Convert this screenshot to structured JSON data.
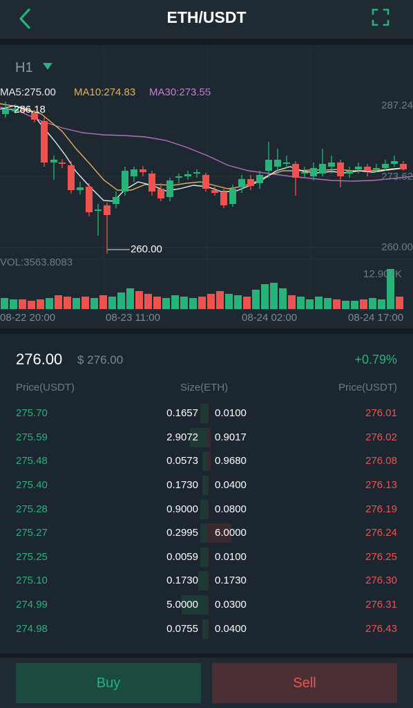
{
  "header": {
    "title": "ETH/USDT",
    "back_icon": "chevron-left-icon",
    "fullscreen_icon": "fullscreen-icon",
    "accent_color": "#27b37a"
  },
  "chart": {
    "timeframe": "H1",
    "ma5": "MA5:275.00",
    "ma10": "MA10:274.83",
    "ma30": "MA30:273.55",
    "y_labels": [
      "287.24",
      "273.62",
      "260.00"
    ],
    "high_label": "286.18",
    "low_label": "260.00",
    "volume_label": "VOL:3563.8083",
    "volume_max": "12.907K",
    "x_labels": [
      "08-22 20:00",
      "08-23 11:00",
      "08-24 02:00",
      "08-24 17:00"
    ],
    "up_color": "#27b37a",
    "down_color": "#ef5350"
  },
  "ticker": {
    "price": "276.00",
    "price_usd": "$ 276.00",
    "change": "+0.79%"
  },
  "orderbook": {
    "headers": {
      "bid_price": "Price(USDT)",
      "size": "Size(ETH)",
      "ask_price": "Price(USDT)"
    },
    "rows": [
      {
        "bid_price": "275.70",
        "bid_size": "0.1657",
        "ask_size": "0.0100",
        "ask_price": "276.01",
        "bid_depth": 0.03,
        "ask_depth": 0.01
      },
      {
        "bid_price": "275.59",
        "bid_size": "2.9072",
        "ask_size": "0.9017",
        "ask_price": "276.02",
        "bid_depth": 0.08,
        "ask_depth": 0.02
      },
      {
        "bid_price": "275.48",
        "bid_size": "0.0573",
        "ask_size": "0.9680",
        "ask_price": "276.08",
        "bid_depth": 0.02,
        "ask_depth": 0.02
      },
      {
        "bid_price": "275.40",
        "bid_size": "0.1730",
        "ask_size": "0.0400",
        "ask_price": "276.13",
        "bid_depth": 0.02,
        "ask_depth": 0.01
      },
      {
        "bid_price": "275.28",
        "bid_size": "0.9000",
        "ask_size": "0.0800",
        "ask_price": "276.19",
        "bid_depth": 0.03,
        "ask_depth": 0.01
      },
      {
        "bid_price": "275.27",
        "bid_size": "0.2995",
        "ask_size": "6.0000",
        "ask_price": "276.24",
        "bid_depth": 0.03,
        "ask_depth": 0.12
      },
      {
        "bid_price": "275.25",
        "bid_size": "0.0059",
        "ask_size": "0.0100",
        "ask_price": "276.25",
        "bid_depth": 0.03,
        "ask_depth": 0.01
      },
      {
        "bid_price": "275.10",
        "bid_size": "0.1730",
        "ask_size": "0.1730",
        "ask_price": "276.30",
        "bid_depth": 0.04,
        "ask_depth": 0.01
      },
      {
        "bid_price": "274.99",
        "bid_size": "5.0000",
        "ask_size": "0.0300",
        "ask_price": "276.31",
        "bid_depth": 0.12,
        "ask_depth": 0.01
      },
      {
        "bid_price": "274.98",
        "bid_size": "0.0755",
        "ask_size": "0.0400",
        "ask_price": "276.43",
        "bid_depth": 0.02,
        "ask_depth": 0.01
      }
    ]
  },
  "actions": {
    "buy": "Buy",
    "sell": "Sell"
  }
}
